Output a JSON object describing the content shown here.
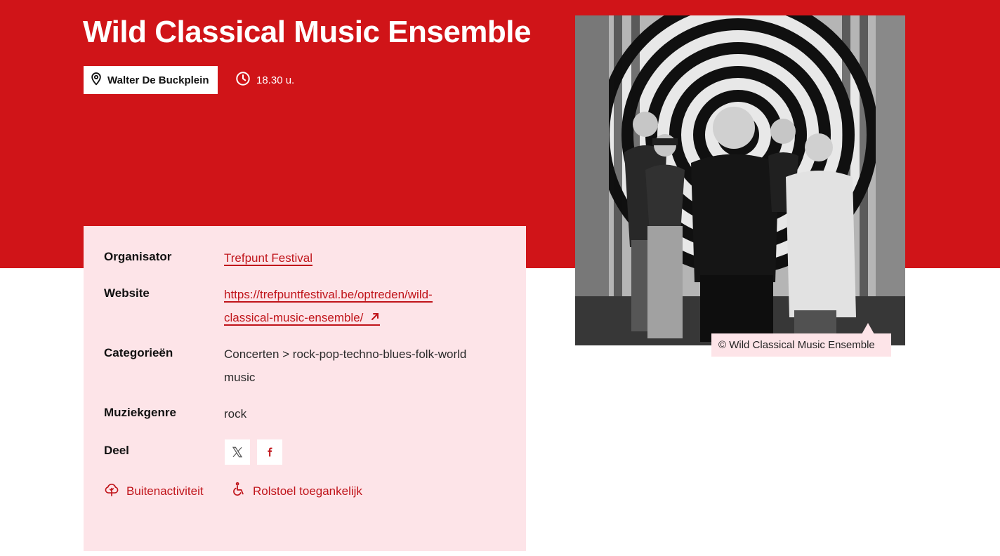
{
  "event": {
    "title": "Wild Classical Music Ensemble",
    "location": "Walter De Buckplein",
    "time": "18.30 u."
  },
  "details": {
    "organizer_label": "Organisator",
    "organizer_value": "Trefpunt Festival",
    "website_label": "Website",
    "website_line1": "https://trefpuntfestival.be/optreden/wild-",
    "website_line2": "classical-music-ensemble/",
    "categories_label": "Categorieën",
    "categories_line1": "Concerten > rock-pop-techno-blues-folk-world",
    "categories_line2": "music",
    "genre_label": "Muziekgenre",
    "genre_value": "rock",
    "share_label": "Deel"
  },
  "share_buttons": [
    {
      "icon": "x-twitter-icon"
    },
    {
      "icon": "facebook-icon"
    }
  ],
  "tags": {
    "outdoor": {
      "label": "Buitenactiviteit",
      "icon": "tree-icon"
    },
    "wheelchair": {
      "label": "Rolstoel toegankelijk",
      "icon": "wheelchair-icon"
    }
  },
  "photo": {
    "caption": "© Wild Classical Music Ensemble"
  },
  "colors": {
    "brand_red": "#d01418",
    "card_pink": "#fde4e8",
    "link_red": "#c0141a"
  }
}
